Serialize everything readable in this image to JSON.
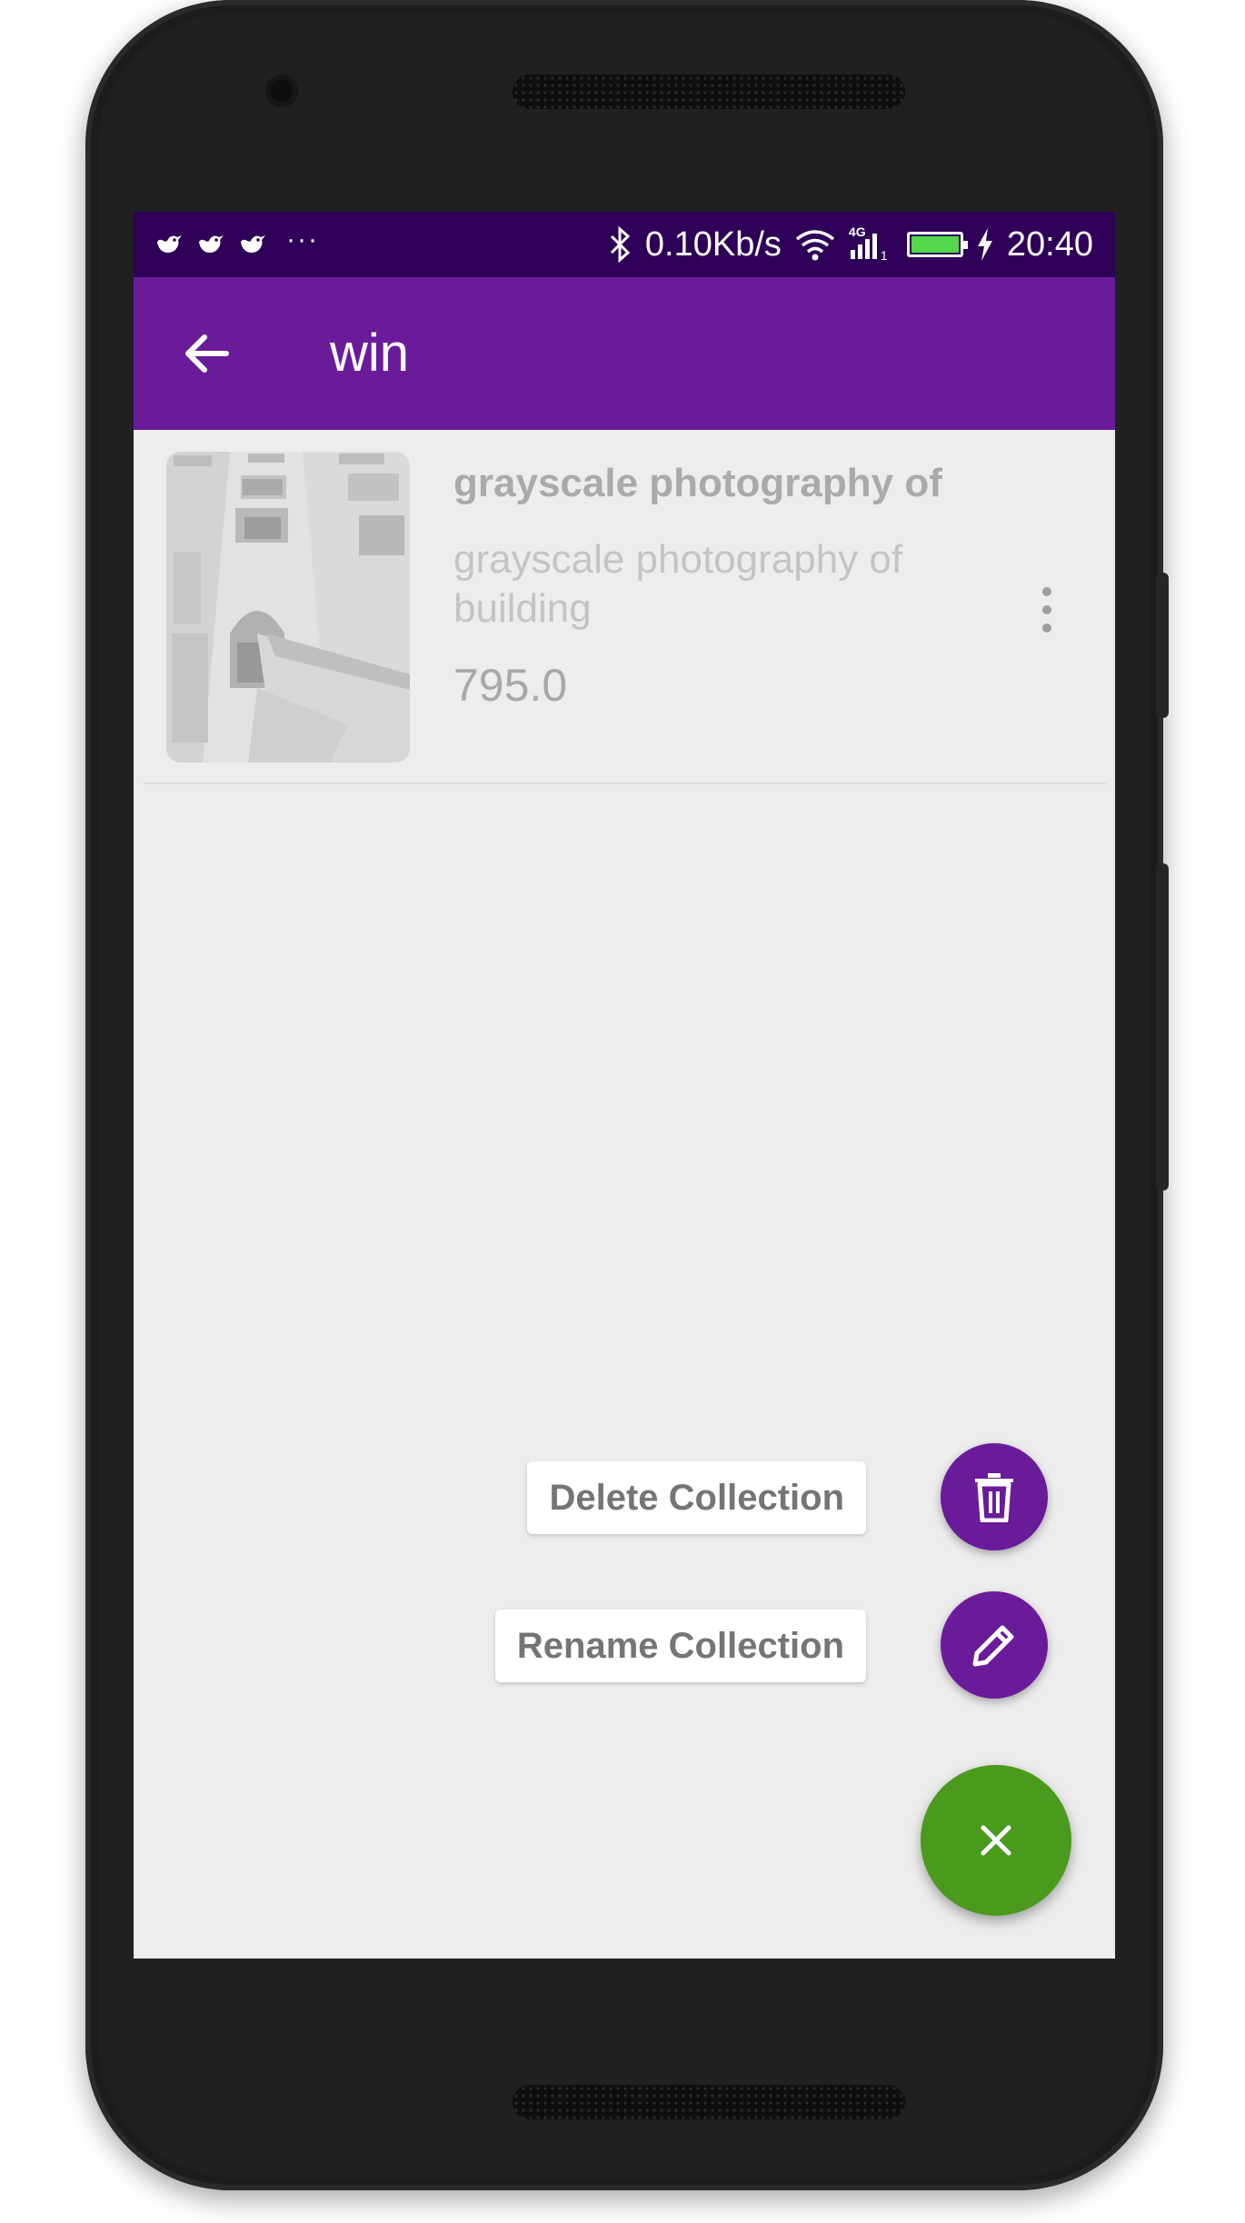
{
  "status_bar": {
    "network_speed": "0.10Kb/s",
    "network_type": "4G",
    "sim_slot": "1",
    "time": "20:40",
    "overflow": "···",
    "icons": [
      "bird-notification-icon",
      "bird-notification-icon",
      "bird-notification-icon",
      "bluetooth-icon",
      "wifi-icon",
      "signal-icon",
      "battery-icon",
      "charging-icon"
    ]
  },
  "app_bar": {
    "title": "win",
    "back_icon": "arrow-back-icon"
  },
  "items": [
    {
      "title": "grayscale photography of",
      "description": "grayscale photography of building",
      "price": "795.0",
      "menu_icon": "more-vert-icon"
    }
  ],
  "fab_menu": {
    "delete_label": "Delete Collection",
    "rename_label": "Rename Collection",
    "delete_icon": "trash-icon",
    "rename_icon": "pencil-icon",
    "close_icon": "close-icon"
  },
  "colors": {
    "primary": "#6a1b9a",
    "status_bar": "#2e0057",
    "fab_main": "#4a9a1d",
    "background": "#ededed"
  }
}
